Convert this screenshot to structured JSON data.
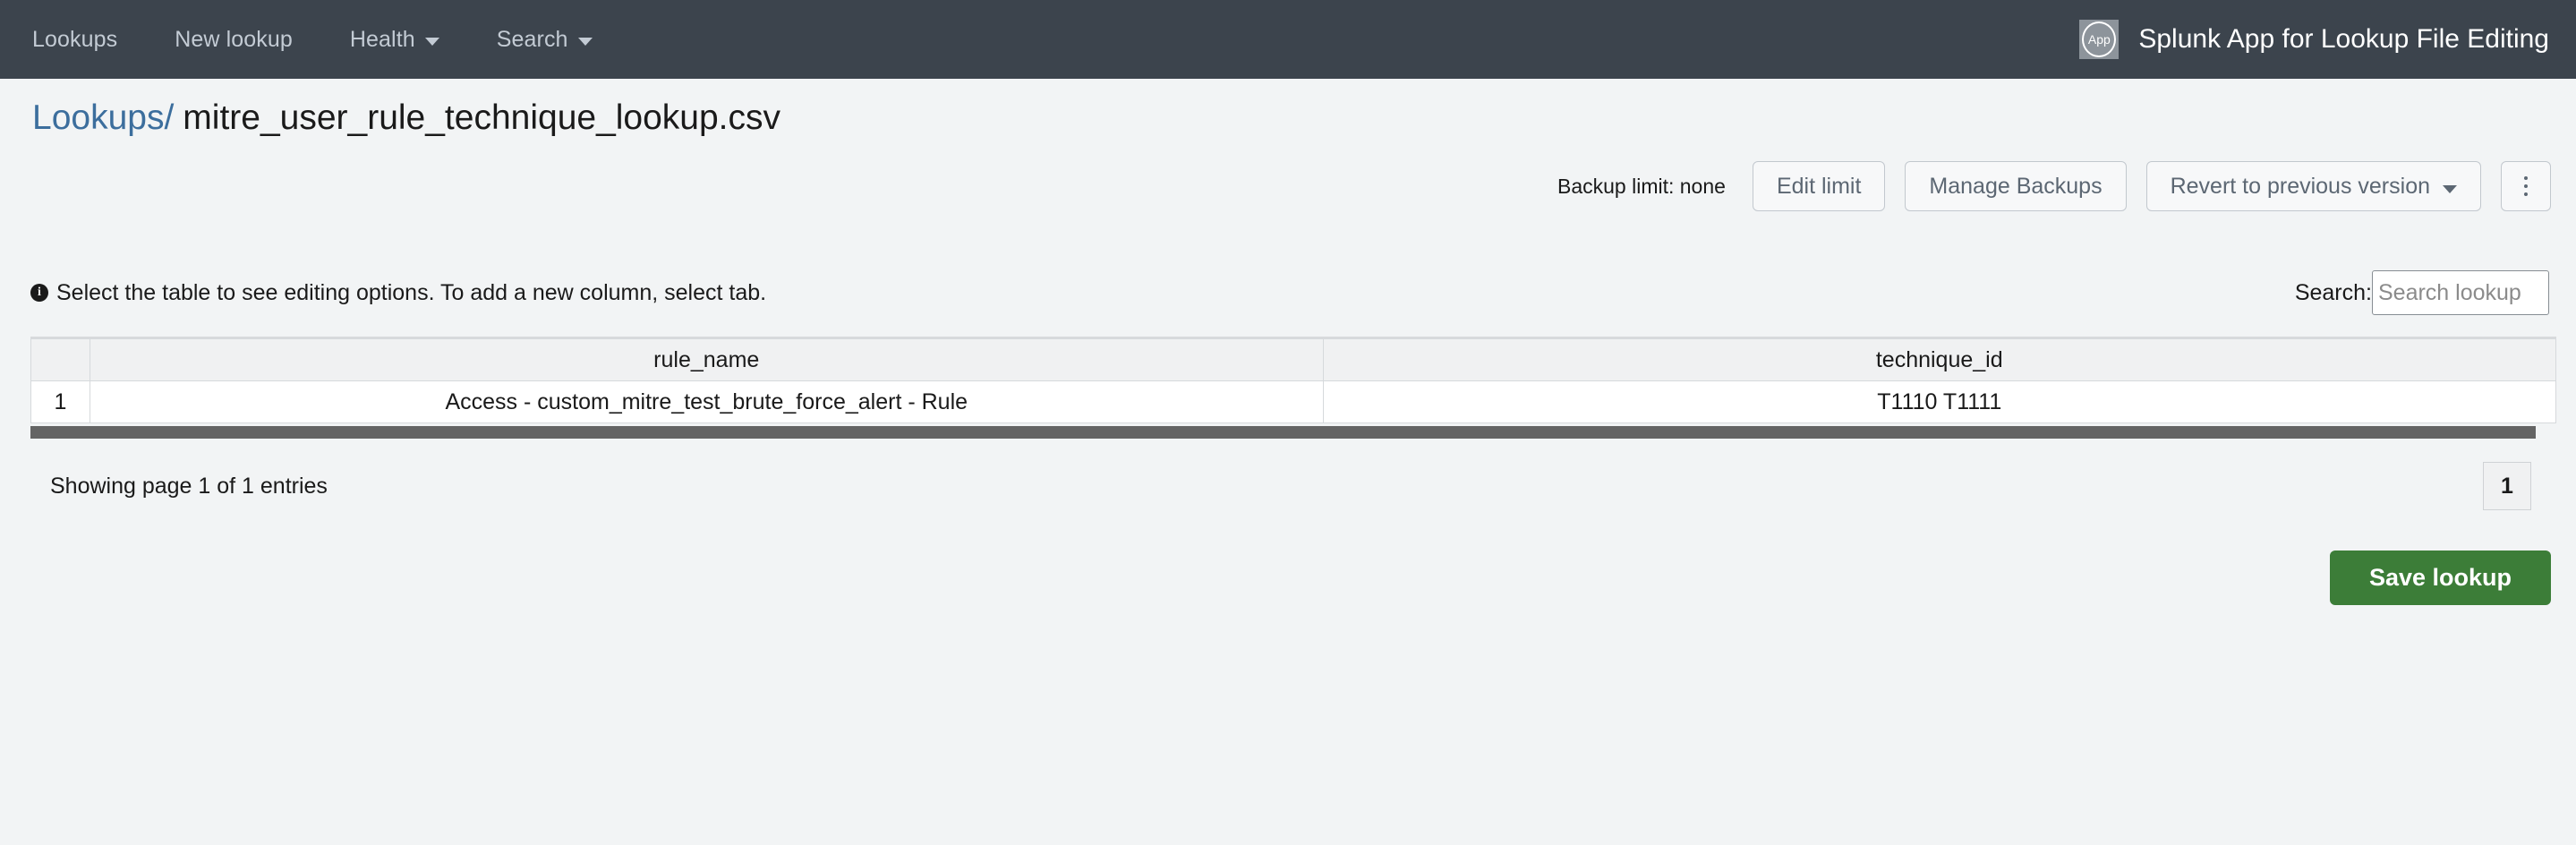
{
  "navbar": {
    "items": [
      {
        "label": "Lookups",
        "has_caret": false
      },
      {
        "label": "New lookup",
        "has_caret": false
      },
      {
        "label": "Health",
        "has_caret": true
      },
      {
        "label": "Search",
        "has_caret": true
      }
    ],
    "logo_text": "App",
    "app_title": "Splunk App for Lookup File Editing",
    "background_color": "#3c444d"
  },
  "page_head": {
    "breadcrumb_link": "Lookups/",
    "file_name": "mitre_user_rule_technique_lookup.csv",
    "link_color": "#3c6e9d"
  },
  "toolbar": {
    "backup_limit_label": "Backup limit: none",
    "edit_limit_label": "Edit limit",
    "manage_backups_label": "Manage Backups",
    "revert_label": "Revert to previous version",
    "kebab_label": "More actions"
  },
  "notice": {
    "icon": "info-icon",
    "text": "Select the table to see editing options. To add a new column, select tab."
  },
  "search": {
    "label": "Search:",
    "placeholder": "Search lookup",
    "value": ""
  },
  "table": {
    "index_header": "",
    "columns": [
      "rule_name",
      "technique_id"
    ],
    "rows": [
      {
        "index": "1",
        "cells": [
          "Access - custom_mitre_test_brute_force_alert - Rule",
          "T1110 T1111"
        ]
      }
    ]
  },
  "footer": {
    "showing_text": "Showing page 1 of 1 entries",
    "current_page": "1"
  },
  "save": {
    "label": "Save lookup",
    "color": "#3c7d38"
  }
}
